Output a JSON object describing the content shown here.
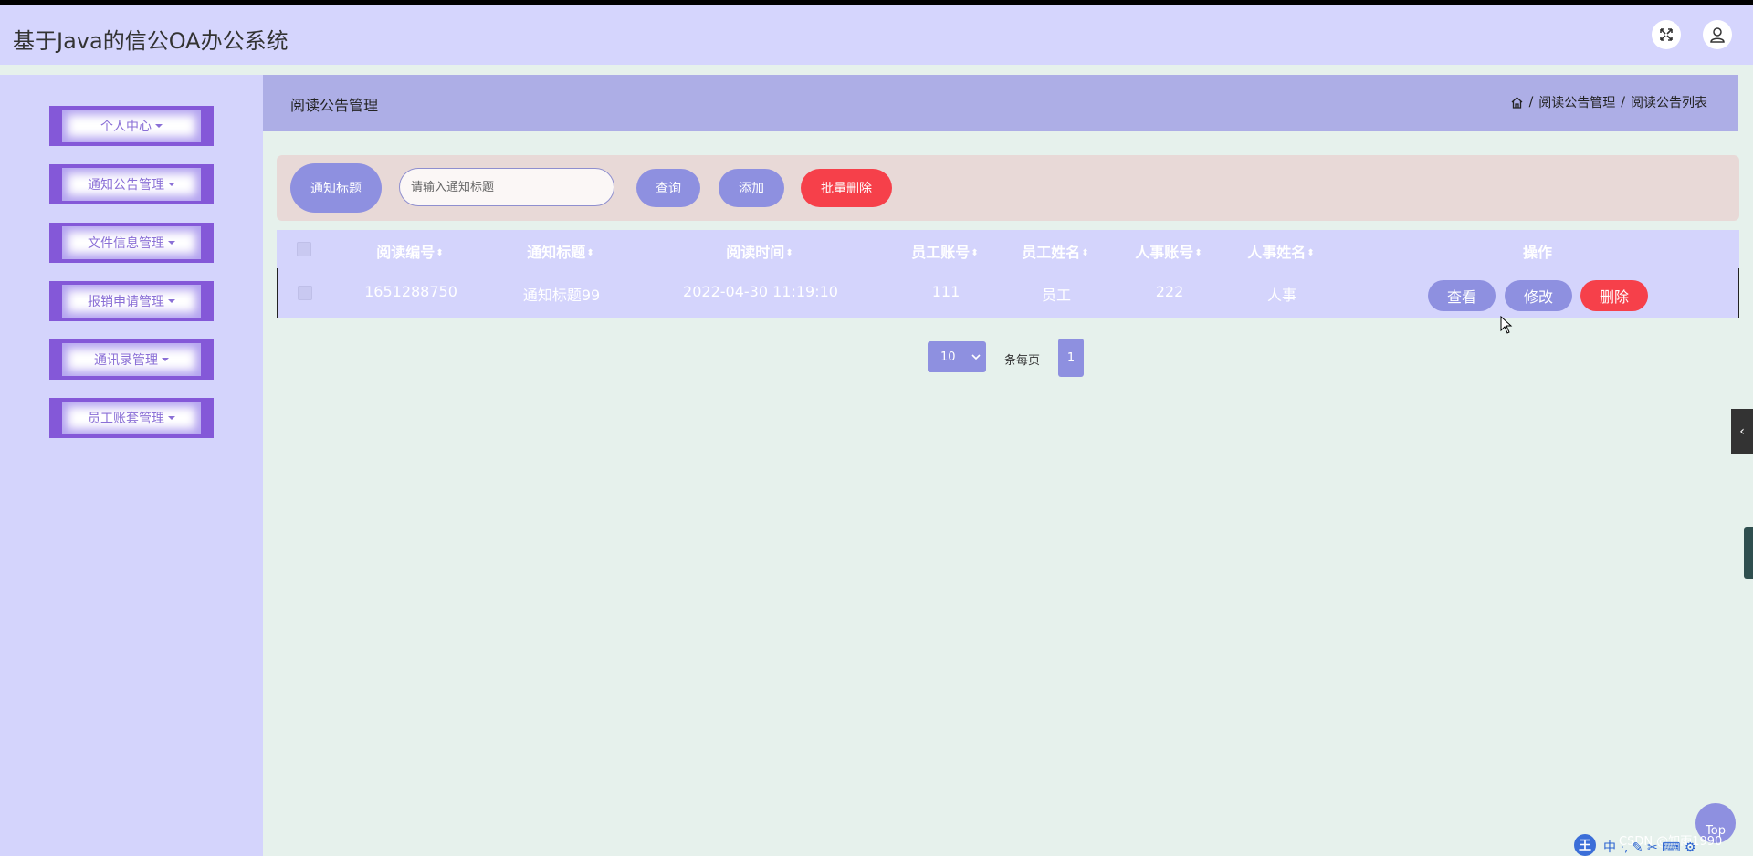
{
  "app": {
    "title": "基于Java的信公OA办公系统"
  },
  "header_icons": {
    "fullscreen": "fullscreen-icon",
    "user": "user-icon"
  },
  "sidebar": {
    "items": [
      {
        "label": "个人中心"
      },
      {
        "label": "通知公告管理"
      },
      {
        "label": "文件信息管理"
      },
      {
        "label": "报销申请管理"
      },
      {
        "label": "通讯录管理"
      },
      {
        "label": "员工账套管理"
      }
    ]
  },
  "page": {
    "title": "阅读公告管理",
    "breadcrumb": {
      "sep": "/",
      "level1": "阅读公告管理",
      "level2": "阅读公告列表"
    }
  },
  "search": {
    "label": "通知标题",
    "placeholder": "请输入通知标题",
    "query_button": "查询",
    "add_button": "添加",
    "batch_delete_button": "批量删除"
  },
  "table": {
    "columns": [
      "阅读编号",
      "通知标题",
      "阅读时间",
      "员工账号",
      "员工姓名",
      "人事账号",
      "人事姓名",
      "操作"
    ],
    "rows": [
      {
        "id": "1651288750",
        "title": "通知标题99",
        "time": "2022-04-30 11:19:10",
        "emp_account": "111",
        "emp_name": "员工",
        "hr_account": "222",
        "hr_name": "人事"
      }
    ],
    "actions": {
      "view": "查看",
      "edit": "修改",
      "delete": "删除"
    }
  },
  "pagination": {
    "page_size": "10",
    "per_page_label": "条每页",
    "current_page": "1"
  },
  "widgets": {
    "top_button": "Top",
    "watermark": "CSDN @知雨1990",
    "side_toggle": "‹"
  },
  "colors": {
    "topbar": "#d5d5fd",
    "sidebar": "#d4d4fc",
    "menu_accent": "#8458d8",
    "header": "#adaee6",
    "primary": "#8e90e0",
    "danger": "#f6404a"
  }
}
